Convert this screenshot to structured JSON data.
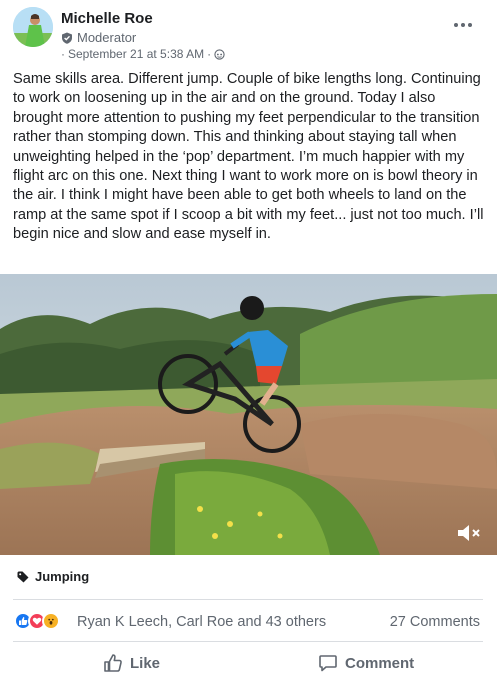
{
  "post": {
    "author": "Michelle Roe",
    "role": "Moderator",
    "timestamp": "September 21 at 5:38 AM",
    "meta_separator": "·",
    "audience_icon": "globe-icon",
    "more_icon": "more-options-icon",
    "body": "Same skills area. Different jump. Couple of bike lengths long. Continuing to work on loosening up in the air and on the ground. Today I also brought more attention to pushing my feet perpendicular to the transition rather than stomping down. This and thinking about staying tall when unweighting helped in the ‘pop’ department. I’m much happier with my flight arc on this one. Next thing I want to work more on is bowl theory in the air. I think I might have been able to get both wheels to land on the ramp at the same spot if I scoop a bit with my feet... just not too much. I’ll begin nice and slow and ease myself in.",
    "tag": "Jumping",
    "tag_icon": "tag-icon"
  },
  "media": {
    "type": "video",
    "mute_icon": "speaker-muted-icon"
  },
  "engagement": {
    "reaction_icons": [
      "like-icon",
      "love-icon",
      "wow-icon"
    ],
    "reactors_text": "Ryan K Leech, Carl Roe and 43 others",
    "comments_text": "27 Comments"
  },
  "actions": {
    "like_label": "Like",
    "comment_label": "Comment"
  },
  "colors": {
    "like_blue": "#1877f2",
    "love_red": "#f33e58",
    "wow_yellow": "#f7b125",
    "secondary_text": "#606770",
    "divider": "#dadde1"
  }
}
